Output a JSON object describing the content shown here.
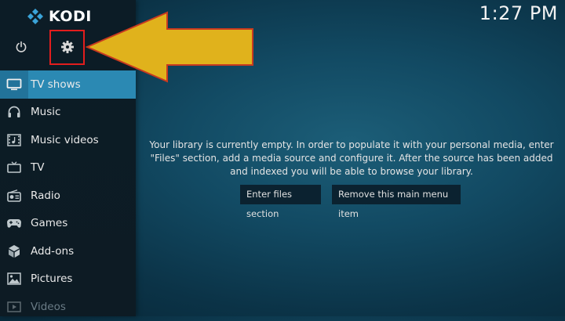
{
  "app": {
    "name": "KODI"
  },
  "clock": {
    "time": "1:27 PM"
  },
  "top_icons": [
    {
      "name": "power-icon"
    },
    {
      "name": "settings-icon"
    },
    {
      "name": "search-icon"
    }
  ],
  "menu": {
    "active_index": 0,
    "items": [
      {
        "label": "TV shows",
        "icon": "tv-shows-icon"
      },
      {
        "label": "Music",
        "icon": "headphones-icon"
      },
      {
        "label": "Music videos",
        "icon": "music-video-icon"
      },
      {
        "label": "TV",
        "icon": "tv-icon"
      },
      {
        "label": "Radio",
        "icon": "radio-icon"
      },
      {
        "label": "Games",
        "icon": "gamepad-icon"
      },
      {
        "label": "Add-ons",
        "icon": "addons-icon"
      },
      {
        "label": "Pictures",
        "icon": "pictures-icon"
      },
      {
        "label": "Videos",
        "icon": "videos-icon"
      }
    ]
  },
  "main": {
    "message": "Your library is currently empty. In order to populate it with your personal media, enter \"Files\" section, add a media source and configure it. After the source has been added and indexed you will be able to browse your library.",
    "buttons": {
      "enter_files": "Enter files section",
      "remove_item": "Remove this main menu item"
    }
  },
  "colors": {
    "accent": "#2b89b3",
    "highlight_box": "#e21d1d",
    "arrow_fill": "#e0b21c",
    "arrow_stroke": "#c83a20"
  }
}
